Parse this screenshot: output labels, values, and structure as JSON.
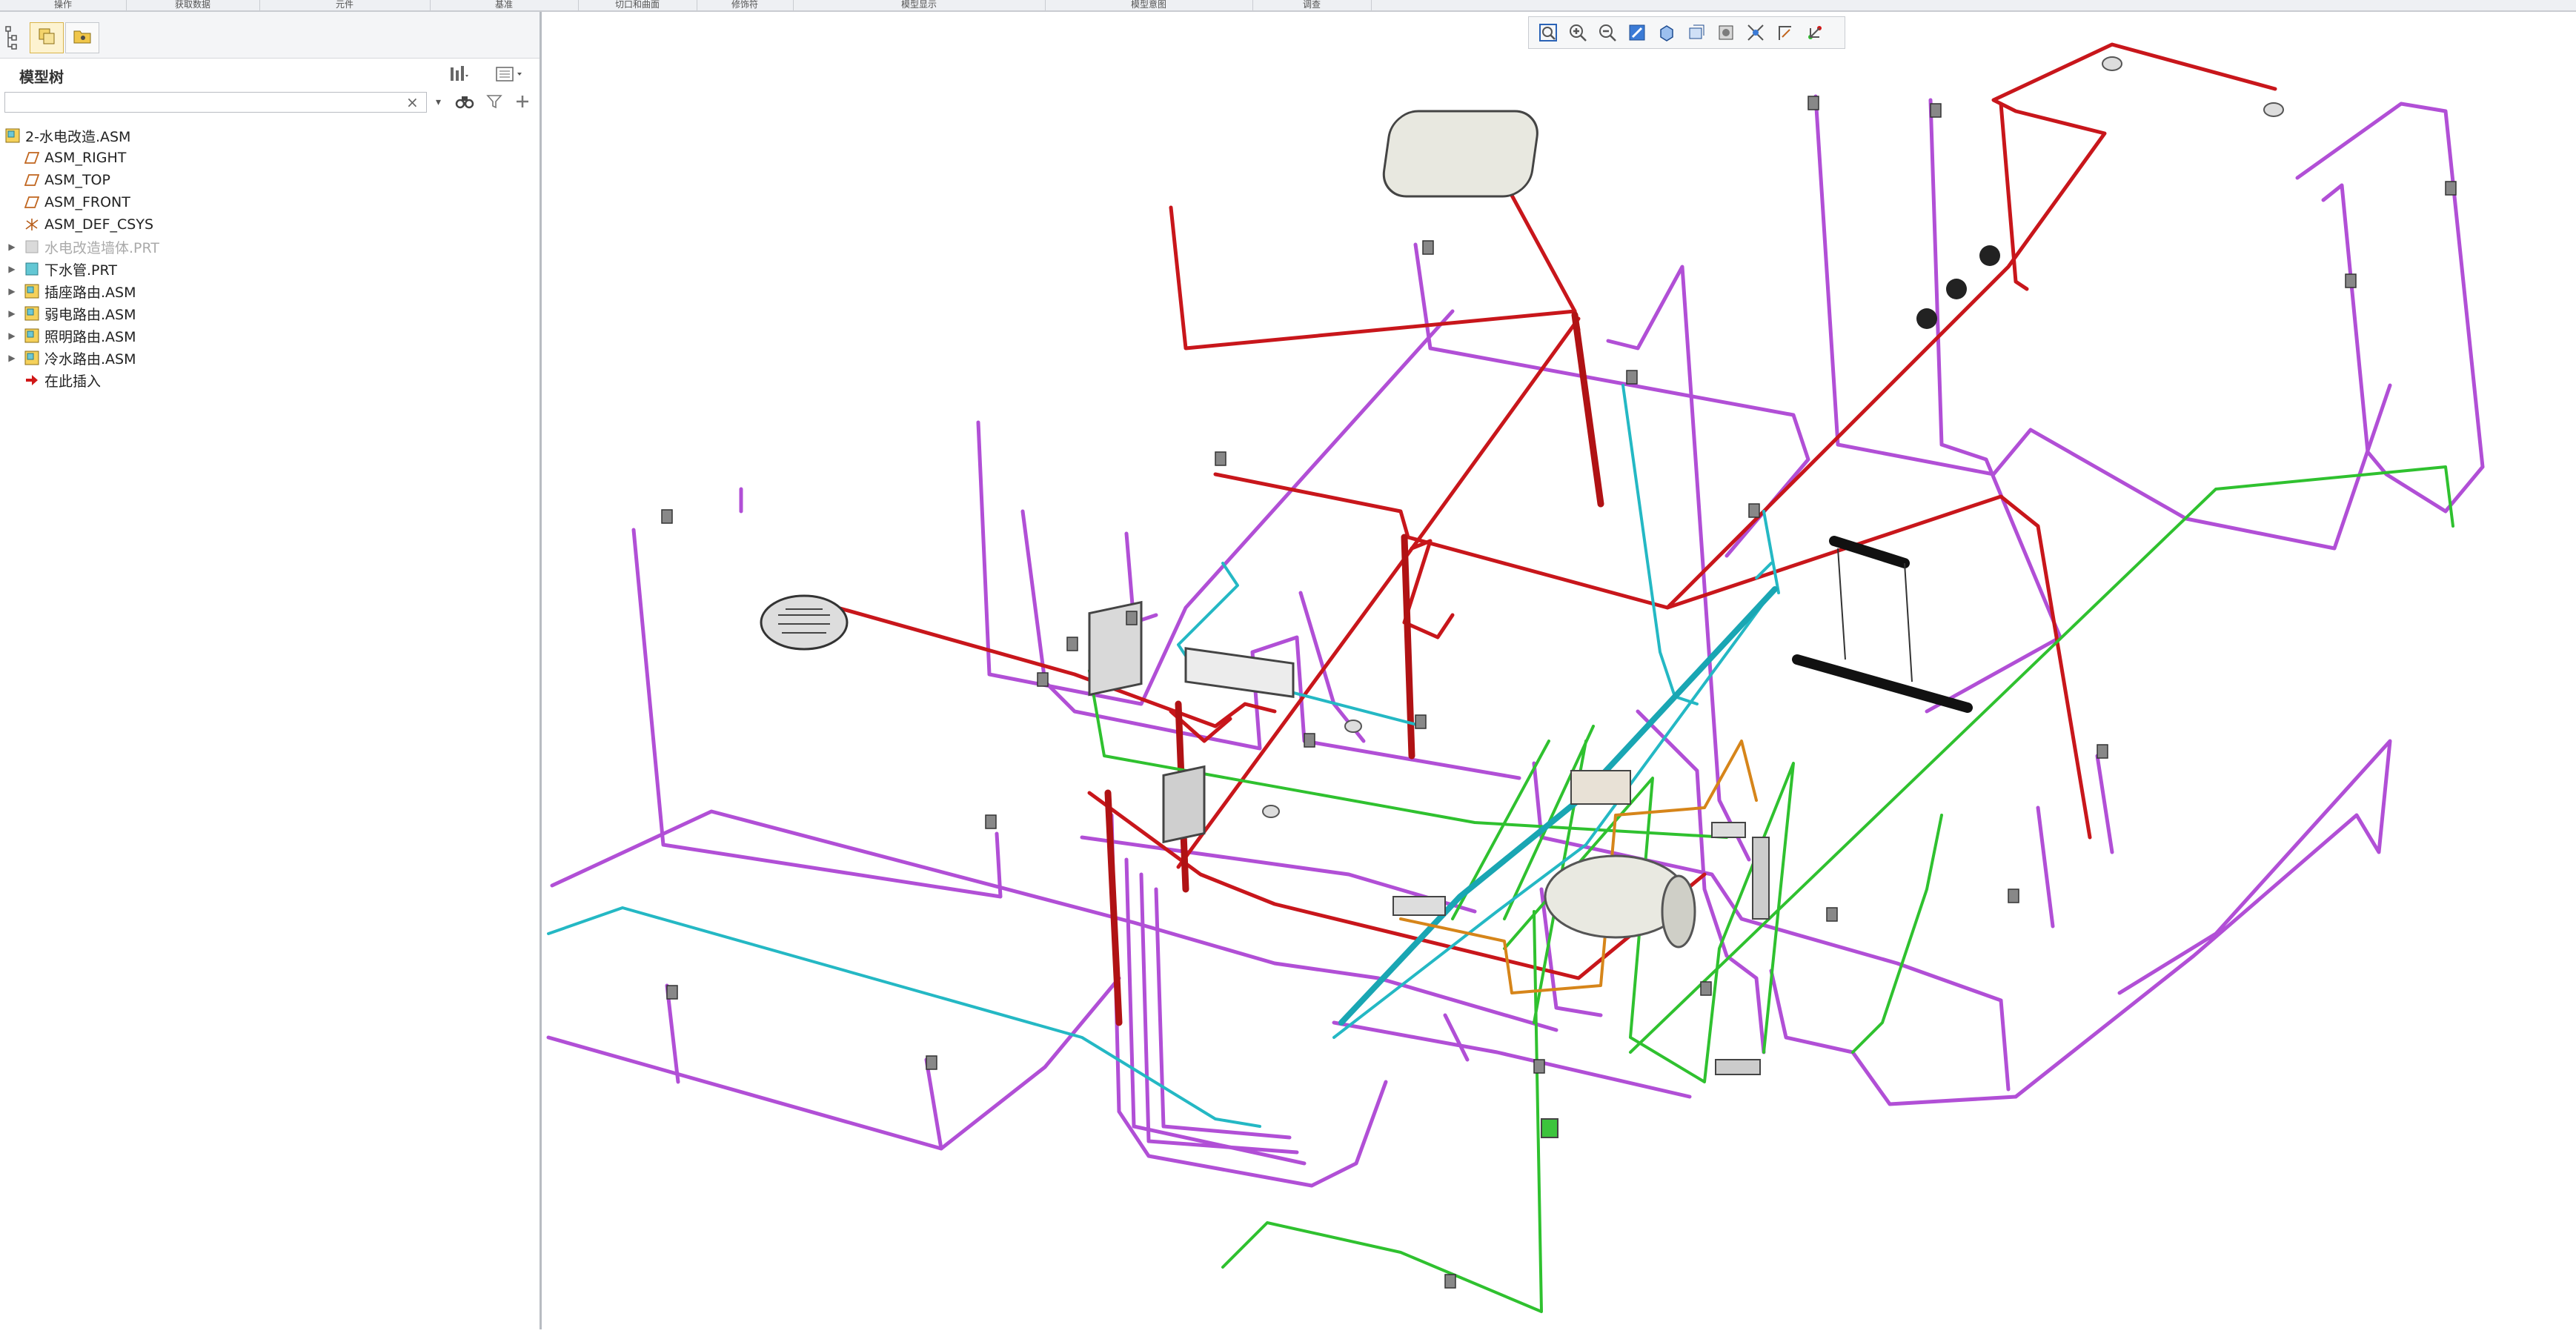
{
  "ribbon": {
    "groups": [
      "操作",
      "获取数据",
      "元件",
      "基准",
      "切口和曲面",
      "修饰符",
      "模型显示",
      "模型意图",
      "调查"
    ]
  },
  "panel": {
    "tabs": [
      {
        "name": "model-tree-tab",
        "icon": "tree-icon",
        "active": false
      },
      {
        "name": "layers-tab",
        "icon": "layers-icon",
        "active": true
      },
      {
        "name": "folder-tab",
        "icon": "folder-icon",
        "active": false
      }
    ],
    "title": "模型树",
    "search": {
      "value": "",
      "placeholder": ""
    }
  },
  "tree": {
    "items": [
      {
        "label": "2-水电改造.ASM",
        "icon": "assembly-icon",
        "level": 0,
        "expander": false,
        "suppressed": false
      },
      {
        "label": "ASM_RIGHT",
        "icon": "datum-plane-icon",
        "level": 1,
        "expander": false,
        "suppressed": false
      },
      {
        "label": "ASM_TOP",
        "icon": "datum-plane-icon",
        "level": 1,
        "expander": false,
        "suppressed": false
      },
      {
        "label": "ASM_FRONT",
        "icon": "datum-plane-icon",
        "level": 1,
        "expander": false,
        "suppressed": false
      },
      {
        "label": "ASM_DEF_CSYS",
        "icon": "csys-icon",
        "level": 1,
        "expander": false,
        "suppressed": false
      },
      {
        "label": "水电改造墙体.PRT",
        "icon": "part-icon",
        "level": 1,
        "expander": true,
        "suppressed": true
      },
      {
        "label": "下水管.PRT",
        "icon": "part-icon",
        "level": 1,
        "expander": true,
        "suppressed": false
      },
      {
        "label": "插座路由.ASM",
        "icon": "assembly-icon",
        "level": 1,
        "expander": true,
        "suppressed": false
      },
      {
        "label": "弱电路由.ASM",
        "icon": "assembly-icon",
        "level": 1,
        "expander": true,
        "suppressed": false
      },
      {
        "label": "照明路由.ASM",
        "icon": "assembly-icon",
        "level": 1,
        "expander": true,
        "suppressed": false
      },
      {
        "label": "冷水路由.ASM",
        "icon": "assembly-icon",
        "level": 1,
        "expander": true,
        "suppressed": false
      },
      {
        "label": "在此插入",
        "icon": "insert-here-icon",
        "level": 1,
        "expander": false,
        "suppressed": false
      }
    ]
  },
  "viewport": {
    "toolbar": [
      "refit-icon",
      "zoom-in-icon",
      "zoom-out-icon",
      "repaint-icon",
      "view-orientation-icon",
      "saved-views-icon",
      "display-style-icon",
      "section-icon",
      "datum-display-icon",
      "annotation-icon",
      "spin-center-icon"
    ],
    "colors": {
      "purple": "#b14fd6",
      "red": "#c8161b",
      "green": "#2fc12f",
      "cyan": "#24b8c4",
      "orange": "#d6851a"
    }
  }
}
